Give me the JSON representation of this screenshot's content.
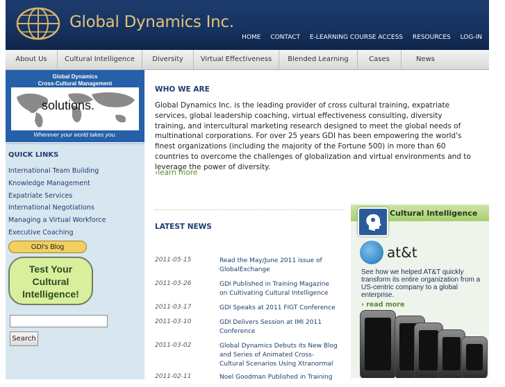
{
  "header": {
    "brand": "Global Dynamics Inc.",
    "topnav": [
      "HOME",
      "CONTACT",
      "E-LEARNING COURSE ACCESS",
      "RESOURCES",
      "LOG-IN"
    ]
  },
  "mainnav": [
    "About Us",
    "Cultural Intelligence",
    "Diversity",
    "Virtual Effectiveness",
    "Blended Learning",
    "Cases",
    "News"
  ],
  "promo": {
    "line1": "Global Dynamics",
    "line2": "Cross-Cultural Management",
    "headline": "solutions.",
    "tagline": "Wherever your world takes you."
  },
  "quick_links": {
    "heading": "QUICK LINKS",
    "items": [
      "International Team Building",
      "Knowledge Management",
      "Expatriate Services",
      "International Negotiations",
      "Managing a Virtual Workforce",
      "Executive Coaching"
    ],
    "blog": "GDI's Blog",
    "test": "Test Your Cultural Intelligence!"
  },
  "search": {
    "value": "",
    "button": "Search"
  },
  "who_we_are": {
    "title": "WHO WE ARE",
    "text": "Global Dynamics Inc. is the leading provider of cross cultural training, expatriate services, global leadership coaching, virtual effectiveness consulting, diversity training, and intercultural marketing research designed to meet the global needs of multinational corporations. For over 25 years GDI has been empowering the world's finest organizations (including the majority of the Fortune 500) in more than 60 countries to overcome the challenges of globalization and virtual environments and to leverage the power of diversity.",
    "learn_more": "learn more"
  },
  "latest_news": {
    "title": "LATEST NEWS",
    "items": [
      {
        "date": "2011-05-15",
        "headline": "Read the May/June 2011 issue of GlobalExchange"
      },
      {
        "date": "2011-03-26",
        "headline": "GDI Published in Training Magazine on Cultivating Cultural Intelligence"
      },
      {
        "date": "2011-03-17",
        "headline": "GDI Speaks at 2011 FIGT Conference"
      },
      {
        "date": "2011-03-10",
        "headline": "GDI Delivers Session at IMI 2011 Conference"
      },
      {
        "date": "2011-03-02",
        "headline": "Global Dynamics Debuts its New Blog and Series of Animated Cross-Cultural Scenarios Using Xtranormal"
      },
      {
        "date": "2011-02-11",
        "headline": "Noel Goodman Published in Training"
      }
    ]
  },
  "cultural_intelligence": {
    "label": "Cultural Intelligence",
    "client": "at&t",
    "description": "See how we helped AT&T quickly transform its entire organization from a US-centric company to a global enterprise.",
    "read_more": "read more"
  },
  "colors": {
    "header_bg": "#1d3c6e",
    "brand_gold": "#e3c27a",
    "link_green": "#5c8a2a",
    "sidebar_bg": "#d8e6f0"
  }
}
